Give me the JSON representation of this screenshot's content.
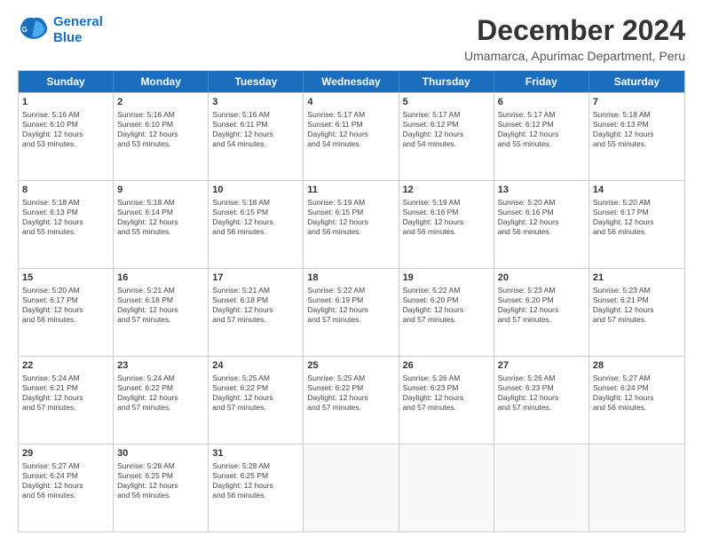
{
  "logo": {
    "line1": "General",
    "line2": "Blue"
  },
  "title": "December 2024",
  "subtitle": "Umamarca, Apurimac Department, Peru",
  "header_days": [
    "Sunday",
    "Monday",
    "Tuesday",
    "Wednesday",
    "Thursday",
    "Friday",
    "Saturday"
  ],
  "weeks": [
    [
      {
        "day": "1",
        "info": "Sunrise: 5:16 AM\nSunset: 6:10 PM\nDaylight: 12 hours\nand 53 minutes."
      },
      {
        "day": "2",
        "info": "Sunrise: 5:16 AM\nSunset: 6:10 PM\nDaylight: 12 hours\nand 53 minutes."
      },
      {
        "day": "3",
        "info": "Sunrise: 5:16 AM\nSunset: 6:11 PM\nDaylight: 12 hours\nand 54 minutes."
      },
      {
        "day": "4",
        "info": "Sunrise: 5:17 AM\nSunset: 6:11 PM\nDaylight: 12 hours\nand 54 minutes."
      },
      {
        "day": "5",
        "info": "Sunrise: 5:17 AM\nSunset: 6:12 PM\nDaylight: 12 hours\nand 54 minutes."
      },
      {
        "day": "6",
        "info": "Sunrise: 5:17 AM\nSunset: 6:12 PM\nDaylight: 12 hours\nand 55 minutes."
      },
      {
        "day": "7",
        "info": "Sunrise: 5:18 AM\nSunset: 6:13 PM\nDaylight: 12 hours\nand 55 minutes."
      }
    ],
    [
      {
        "day": "8",
        "info": "Sunrise: 5:18 AM\nSunset: 6:13 PM\nDaylight: 12 hours\nand 55 minutes."
      },
      {
        "day": "9",
        "info": "Sunrise: 5:18 AM\nSunset: 6:14 PM\nDaylight: 12 hours\nand 55 minutes."
      },
      {
        "day": "10",
        "info": "Sunrise: 5:18 AM\nSunset: 6:15 PM\nDaylight: 12 hours\nand 56 minutes."
      },
      {
        "day": "11",
        "info": "Sunrise: 5:19 AM\nSunset: 6:15 PM\nDaylight: 12 hours\nand 56 minutes."
      },
      {
        "day": "12",
        "info": "Sunrise: 5:19 AM\nSunset: 6:16 PM\nDaylight: 12 hours\nand 56 minutes."
      },
      {
        "day": "13",
        "info": "Sunrise: 5:20 AM\nSunset: 6:16 PM\nDaylight: 12 hours\nand 56 minutes."
      },
      {
        "day": "14",
        "info": "Sunrise: 5:20 AM\nSunset: 6:17 PM\nDaylight: 12 hours\nand 56 minutes."
      }
    ],
    [
      {
        "day": "15",
        "info": "Sunrise: 5:20 AM\nSunset: 6:17 PM\nDaylight: 12 hours\nand 56 minutes."
      },
      {
        "day": "16",
        "info": "Sunrise: 5:21 AM\nSunset: 6:18 PM\nDaylight: 12 hours\nand 57 minutes."
      },
      {
        "day": "17",
        "info": "Sunrise: 5:21 AM\nSunset: 6:18 PM\nDaylight: 12 hours\nand 57 minutes."
      },
      {
        "day": "18",
        "info": "Sunrise: 5:22 AM\nSunset: 6:19 PM\nDaylight: 12 hours\nand 57 minutes."
      },
      {
        "day": "19",
        "info": "Sunrise: 5:22 AM\nSunset: 6:20 PM\nDaylight: 12 hours\nand 57 minutes."
      },
      {
        "day": "20",
        "info": "Sunrise: 5:23 AM\nSunset: 6:20 PM\nDaylight: 12 hours\nand 57 minutes."
      },
      {
        "day": "21",
        "info": "Sunrise: 5:23 AM\nSunset: 6:21 PM\nDaylight: 12 hours\nand 57 minutes."
      }
    ],
    [
      {
        "day": "22",
        "info": "Sunrise: 5:24 AM\nSunset: 6:21 PM\nDaylight: 12 hours\nand 57 minutes."
      },
      {
        "day": "23",
        "info": "Sunrise: 5:24 AM\nSunset: 6:22 PM\nDaylight: 12 hours\nand 57 minutes."
      },
      {
        "day": "24",
        "info": "Sunrise: 5:25 AM\nSunset: 6:22 PM\nDaylight: 12 hours\nand 57 minutes."
      },
      {
        "day": "25",
        "info": "Sunrise: 5:25 AM\nSunset: 6:22 PM\nDaylight: 12 hours\nand 57 minutes."
      },
      {
        "day": "26",
        "info": "Sunrise: 5:26 AM\nSunset: 6:23 PM\nDaylight: 12 hours\nand 57 minutes."
      },
      {
        "day": "27",
        "info": "Sunrise: 5:26 AM\nSunset: 6:23 PM\nDaylight: 12 hours\nand 57 minutes."
      },
      {
        "day": "28",
        "info": "Sunrise: 5:27 AM\nSunset: 6:24 PM\nDaylight: 12 hours\nand 56 minutes."
      }
    ],
    [
      {
        "day": "29",
        "info": "Sunrise: 5:27 AM\nSunset: 6:24 PM\nDaylight: 12 hours\nand 56 minutes."
      },
      {
        "day": "30",
        "info": "Sunrise: 5:28 AM\nSunset: 6:25 PM\nDaylight: 12 hours\nand 56 minutes."
      },
      {
        "day": "31",
        "info": "Sunrise: 5:28 AM\nSunset: 6:25 PM\nDaylight: 12 hours\nand 56 minutes."
      },
      {
        "day": "",
        "info": ""
      },
      {
        "day": "",
        "info": ""
      },
      {
        "day": "",
        "info": ""
      },
      {
        "day": "",
        "info": ""
      }
    ]
  ]
}
